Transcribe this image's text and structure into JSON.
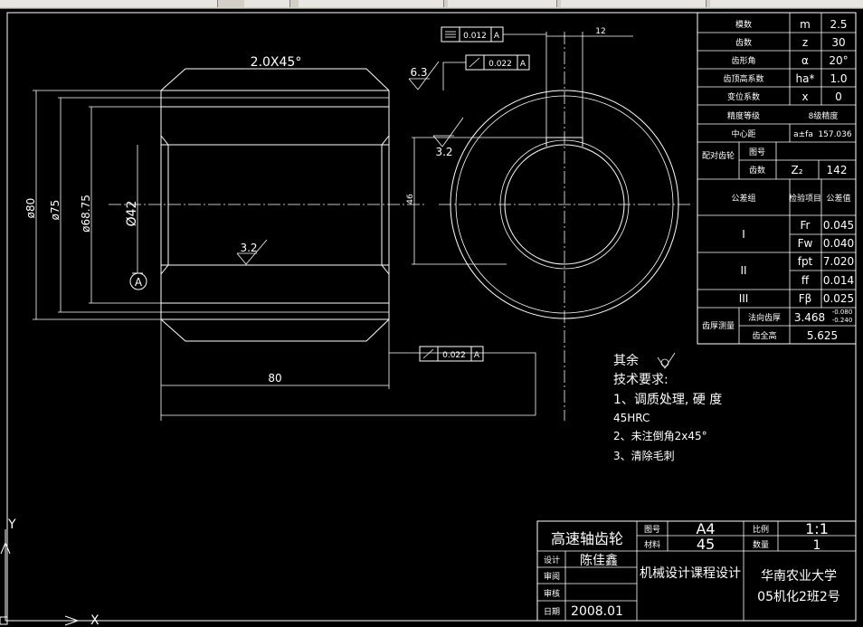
{
  "drawing": {
    "chamfer_label": "2.0X45°",
    "roughness_top": "6.3",
    "roughness_center": "3.2",
    "roughness_bore": "3.2",
    "flatness_value": "0.012",
    "flatness_datum": "A",
    "runout1_value": "0.022",
    "runout1_datum": "A",
    "runout2_value": "0.022",
    "runout2_datum": "A",
    "keyway_width": "12",
    "keyway_depth": "46",
    "dim_80": "80",
    "dim_d80": "ø80",
    "dim_d75": "ø75",
    "dim_d68": "ø68.75",
    "dim_d42": "Ø42",
    "datum_label": "A",
    "ucs_y": "Y",
    "ucs_x": "X"
  },
  "param_table": {
    "rows": [
      {
        "label": "模数",
        "sym": "m",
        "val": "2.5"
      },
      {
        "label": "齿数",
        "sym": "z",
        "val": "30"
      },
      {
        "label": "齿形角",
        "sym": "α",
        "val": "20°"
      },
      {
        "label": "齿顶高系数",
        "sym": "ha*",
        "val": "1.0"
      },
      {
        "label": "变位系数",
        "sym": "x",
        "val": "0"
      },
      {
        "label": "精度等级",
        "sym": "",
        "val": "8级精度"
      },
      {
        "label": "中心距",
        "sym": "a±fa",
        "val": "157.036"
      },
      {
        "label": "配对齿轮",
        "sym": "图号",
        "val": ""
      },
      {
        "label": "",
        "sym": "齿数",
        "val": "142",
        "sym2": "Z₂"
      },
      {
        "label": "公差组",
        "sym": "检验项目",
        "val": "公差值"
      },
      {
        "label": "I",
        "sym": "Fr",
        "val": "0.045"
      },
      {
        "label": "",
        "sym": "Fw",
        "val": "0.040"
      },
      {
        "label": "II",
        "sym": "fpt",
        "val": "7.020"
      },
      {
        "label": "",
        "sym": "ff",
        "val": "0.014"
      },
      {
        "label": "III",
        "sym": "Fβ",
        "val": "0.025"
      },
      {
        "label": "齿厚测量",
        "sym": "法向齿厚",
        "val": "3.468"
      },
      {
        "label": "",
        "sym": "齿全高",
        "val": "5.625"
      }
    ],
    "tol_upper": "-0.080",
    "tol_lower": "-0.240"
  },
  "notes": {
    "other": "其余",
    "title": "技术要求:",
    "line1": "1、调质处理, 硬  度",
    "line2": "45HRC",
    "line3": "2、未注倒角2x45°",
    "line4": "3、清除毛刺"
  },
  "title_block": {
    "part_name": "高速轴齿轮",
    "drawing_no_label": "图号",
    "drawing_no": "A4",
    "material_label": "材料",
    "material": "45",
    "scale_label": "比例",
    "scale": "1:1",
    "qty_label": "数量",
    "qty": "1",
    "design_label": "设计",
    "designer": "陈佳鑫",
    "review_label": "审阅",
    "check_label": "审核",
    "date_label": "日期",
    "date": "2008.01",
    "course": "机械设计课程设计",
    "school": "华南农业大学",
    "class": "05机化2班2号"
  }
}
